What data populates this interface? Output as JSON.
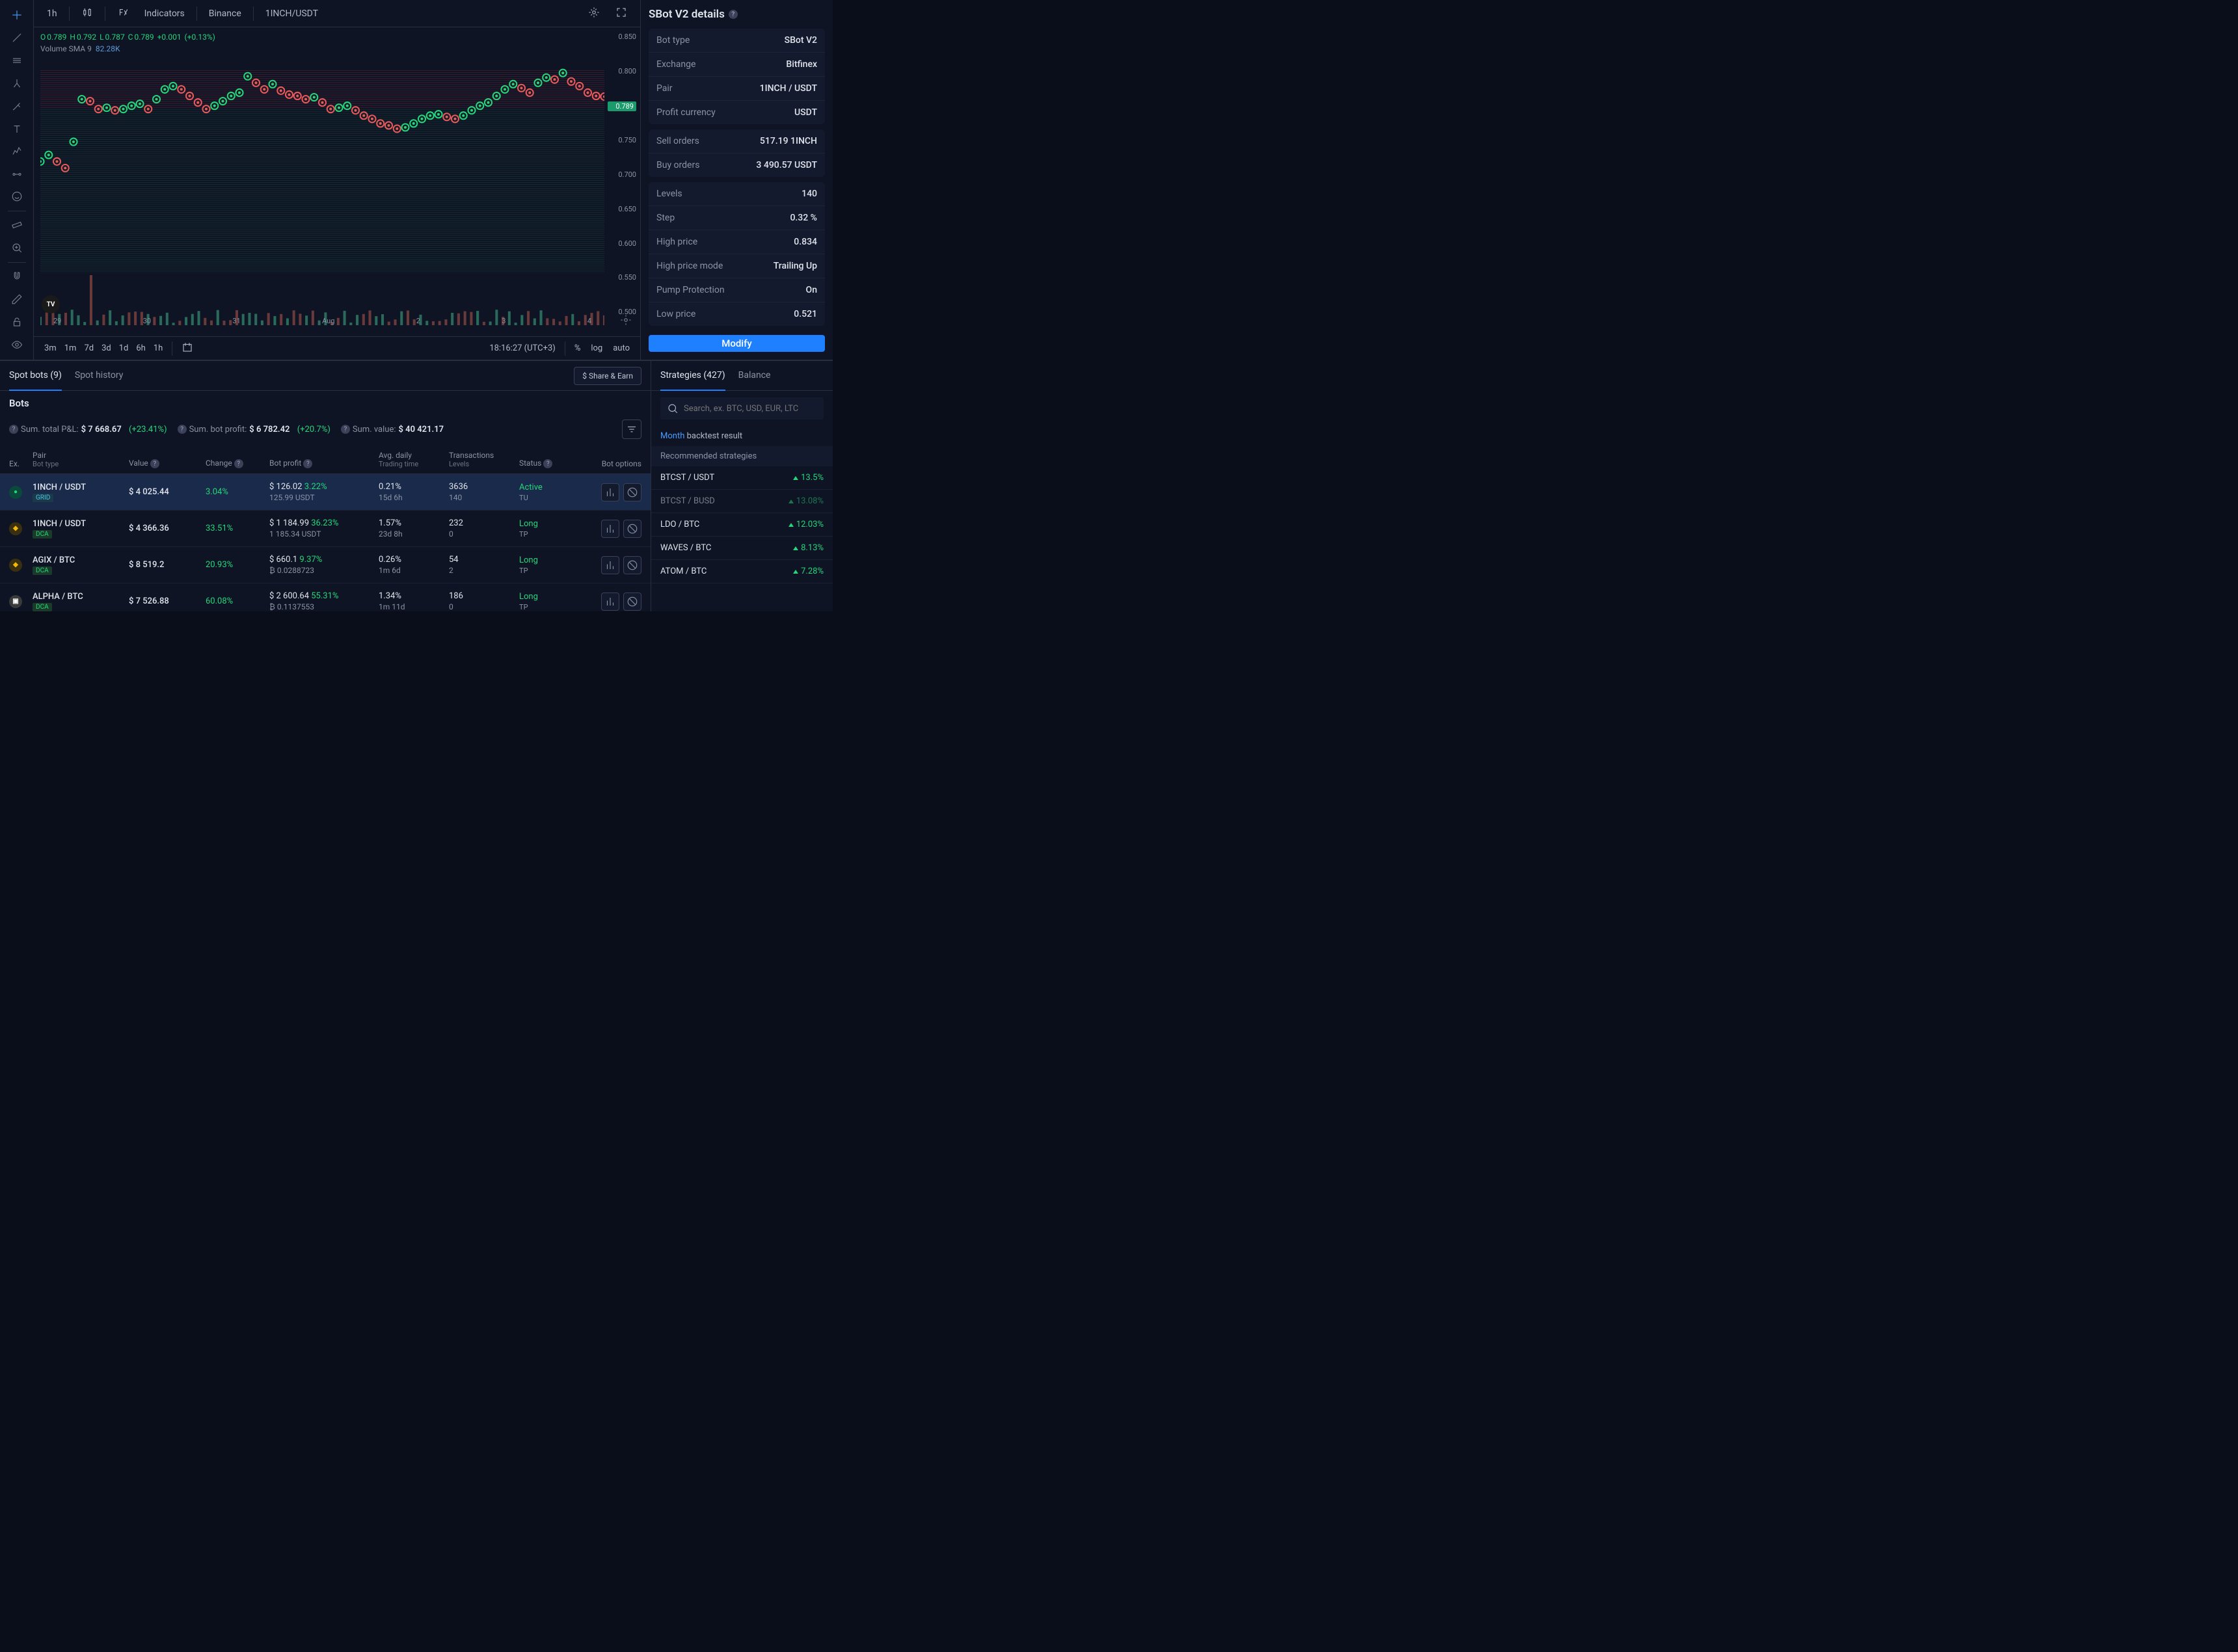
{
  "toolbar": {
    "timeframe": "1h",
    "indicators": "Indicators",
    "exchange": "Binance",
    "symbol": "1INCH/USDT"
  },
  "ohlc": {
    "o_label": "O",
    "o": "0.789",
    "h_label": "H",
    "h": "0.792",
    "l_label": "L",
    "l": "0.787",
    "c_label": "C",
    "c": "0.789",
    "chg": "+0.001",
    "chg_pct": "(+0.13%)"
  },
  "volume": {
    "label": "Volume SMA 9",
    "value": "82.28K"
  },
  "chart_data": {
    "type": "line",
    "title": "",
    "xlabel": "",
    "ylabel": "",
    "ylim": [
      0.5,
      0.85
    ],
    "y_ticks": [
      "0.850",
      "0.800",
      "0.789",
      "0.750",
      "0.700",
      "0.650",
      "0.600",
      "0.550",
      "0.500"
    ],
    "current_price": "0.789",
    "x_ticks": [
      "29",
      "30",
      "31",
      "Aug",
      "2",
      "3",
      "4"
    ],
    "series": [
      {
        "name": "1INCH/USDT",
        "values": [
          0.69,
          0.7,
          0.69,
          0.68,
          0.72,
          0.785,
          0.782,
          0.77,
          0.772,
          0.768,
          0.77,
          0.775,
          0.778,
          0.77,
          0.785,
          0.8,
          0.805,
          0.8,
          0.79,
          0.78,
          0.77,
          0.775,
          0.782,
          0.79,
          0.795,
          0.82,
          0.81,
          0.8,
          0.808,
          0.798,
          0.792,
          0.79,
          0.785,
          0.788,
          0.78,
          0.77,
          0.772,
          0.775,
          0.768,
          0.76,
          0.755,
          0.748,
          0.745,
          0.74,
          0.742,
          0.748,
          0.755,
          0.76,
          0.762,
          0.758,
          0.755,
          0.76,
          0.768,
          0.775,
          0.78,
          0.79,
          0.8,
          0.808,
          0.802,
          0.795,
          0.81,
          0.818,
          0.815,
          0.825,
          0.812,
          0.805,
          0.795,
          0.79,
          0.789
        ]
      }
    ]
  },
  "time_bar": {
    "ranges": [
      "3m",
      "1m",
      "7d",
      "3d",
      "1d",
      "6h",
      "1h"
    ],
    "clock": "18:16:27 (UTC+3)",
    "pct": "%",
    "log": "log",
    "auto": "auto"
  },
  "details": {
    "title": "SBot V2 details",
    "rows1": [
      {
        "label": "Bot type",
        "value": "SBot V2"
      },
      {
        "label": "Exchange",
        "value": "Bitfinex"
      },
      {
        "label": "Pair",
        "value": "1INCH / USDT"
      },
      {
        "label": "Profit currency",
        "value": "USDT"
      }
    ],
    "rows2": [
      {
        "label": "Sell orders",
        "value": "517.19 1INCH"
      },
      {
        "label": "Buy orders",
        "value": "3 490.57 USDT"
      }
    ],
    "rows3": [
      {
        "label": "Levels",
        "value": "140"
      },
      {
        "label": "Step",
        "value": "0.32 %"
      },
      {
        "label": "High price",
        "value": "0.834"
      },
      {
        "label": "High price mode",
        "value": "Trailing Up"
      },
      {
        "label": "Pump Protection",
        "value": "On"
      },
      {
        "label": "Low price",
        "value": "0.521"
      }
    ],
    "modify": "Modify"
  },
  "bots_tabs": {
    "active": "Spot bots (9)",
    "history": "Spot history",
    "share": "$ Share & Earn"
  },
  "bots_summary": {
    "title": "Bots",
    "pnl_label": "Sum. total P&L:",
    "pnl": "$ 7 668.67",
    "pnl_pct": "(+23.41%)",
    "profit_label": "Sum. bot profit:",
    "profit": "$ 6 782.42",
    "profit_pct": "(+20.7%)",
    "value_label": "Sum. value:",
    "value": "$ 40 421.17"
  },
  "bots_cols": {
    "ex": "Ex.",
    "pair": "Pair",
    "pair_sub": "Bot type",
    "value": "Value",
    "change": "Change",
    "profit": "Bot profit",
    "daily": "Avg. daily",
    "daily_sub": "Trading time",
    "trans": "Transactions",
    "trans_sub": "Levels",
    "status": "Status",
    "opts": "Bot options"
  },
  "bots": [
    {
      "ex": "bitfinex",
      "pair": "1INCH / USDT",
      "type": "GRID",
      "value": "$ 4 025.44",
      "change": "3.04%",
      "profit": "$ 126.02",
      "profit_pct": "3.22%",
      "profit_sub": "125.99 USDT",
      "daily": "0.21%",
      "daily_sub": "15d 6h",
      "trans": "3636",
      "trans_sub": "140",
      "status": "Active",
      "status_sub": "TU",
      "selected": true
    },
    {
      "ex": "binance",
      "pair": "1INCH / USDT",
      "type": "DCA",
      "value": "$ 4 366.36",
      "change": "33.51%",
      "profit": "$ 1 184.99",
      "profit_pct": "36.23%",
      "profit_sub": "1 185.34 USDT",
      "daily": "1.57%",
      "daily_sub": "23d 8h",
      "trans": "232",
      "trans_sub": "0",
      "status": "Long",
      "status_sub": "TP"
    },
    {
      "ex": "binance",
      "pair": "AGIX / BTC",
      "type": "DCA",
      "value": "$ 8 519.2",
      "change": "20.93%",
      "profit": "$ 660.1",
      "profit_pct": "9.37%",
      "profit_sub": "₿ 0.0288723",
      "daily": "0.26%",
      "daily_sub": "1m 6d",
      "trans": "54",
      "trans_sub": "2",
      "status": "Long",
      "status_sub": "TP"
    },
    {
      "ex": "other",
      "pair": "ALPHA / BTC",
      "type": "DCA",
      "value": "$ 7 526.88",
      "change": "60.08%",
      "profit": "$ 2 600.64",
      "profit_pct": "55.31%",
      "profit_sub": "₿ 0.1137553",
      "daily": "1.34%",
      "daily_sub": "1m 11d",
      "trans": "186",
      "trans_sub": "0",
      "status": "Long",
      "status_sub": "TP"
    }
  ],
  "strategies": {
    "tab1": "Strategies (427)",
    "tab2": "Balance",
    "search_ph": "Search, ex. BTC, USD, EUR, LTC",
    "month": "Month",
    "backtest": "backtest result",
    "subhead": "Recommended strategies",
    "items": [
      {
        "name": "BTCST / USDT",
        "pct": "13.5%"
      },
      {
        "name": "BTCST / BUSD",
        "pct": "13.08%",
        "dim": true
      },
      {
        "name": "LDO / BTC",
        "pct": "12.03%"
      },
      {
        "name": "WAVES / BTC",
        "pct": "8.13%"
      },
      {
        "name": "ATOM / BTC",
        "pct": "7.28%"
      }
    ]
  }
}
